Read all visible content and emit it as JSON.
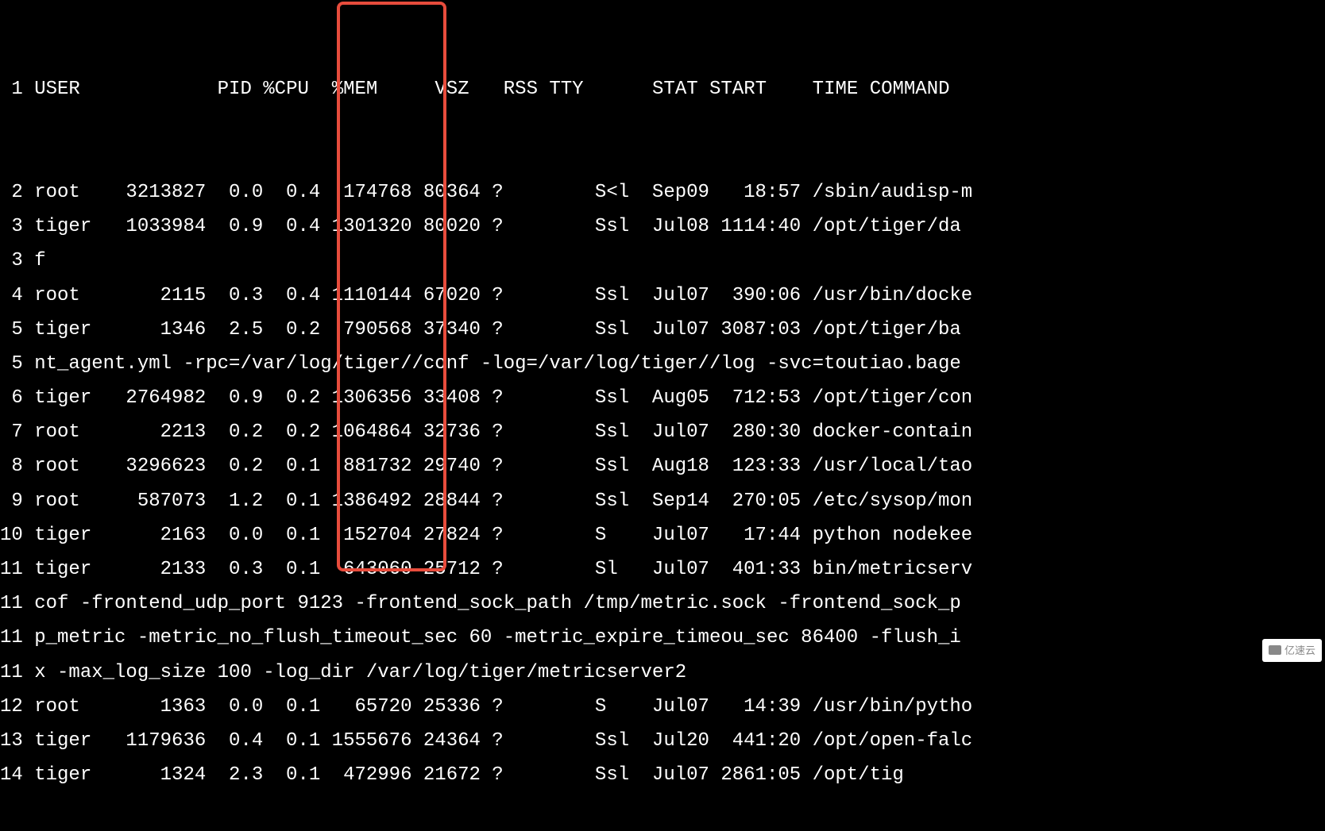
{
  "header": {
    "num": " 1",
    "user": "USER",
    "pid": "    PID",
    "cpu": "%CPU",
    "mem": "%MEM",
    "vsz": "    VSZ",
    "rss": "  RSS",
    "tty": "TTY",
    "stat": "STAT",
    "start": "START",
    "time": "   TIME",
    "command": "COMMAND"
  },
  "rows": [
    {
      "num": " 2",
      "user": "root ",
      "pid": "3213827",
      "cpu": " 0.0",
      "mem": " 0.4",
      "vsz": " 174768",
      "rss": "80364",
      "tty": "?       ",
      "stat": "S<l ",
      "start": "Sep09",
      "time": "  18:57",
      "command": "/sbin/audisp-m"
    },
    {
      "num": " 3",
      "user": "tiger",
      "pid": "1033984",
      "cpu": " 0.9",
      "mem": " 0.4",
      "vsz": "1301320",
      "rss": "80020",
      "tty": "?       ",
      "stat": "Ssl ",
      "start": "Jul08",
      "time": "1114:40",
      "command": "/opt/tiger/da"
    },
    {
      "num": " 3",
      "wrap": "f"
    },
    {
      "num": " 4",
      "user": "root ",
      "pid": "   2115",
      "cpu": " 0.3",
      "mem": " 0.4",
      "vsz": "1110144",
      "rss": "67020",
      "tty": "?       ",
      "stat": "Ssl ",
      "start": "Jul07",
      "time": " 390:06",
      "command": "/usr/bin/docke"
    },
    {
      "num": " 5",
      "user": "tiger",
      "pid": "   1346",
      "cpu": " 2.5",
      "mem": " 0.2",
      "vsz": " 790568",
      "rss": "37340",
      "tty": "?       ",
      "stat": "Ssl ",
      "start": "Jul07",
      "time": "3087:03",
      "command": "/opt/tiger/ba"
    },
    {
      "num": " 5",
      "wrap": "nt_agent.yml -rpc=/var/log/tiger//conf -log=/var/log/tiger//log -svc=toutiao.bage"
    },
    {
      "num": " 6",
      "user": "tiger",
      "pid": "2764982",
      "cpu": " 0.9",
      "mem": " 0.2",
      "vsz": "1306356",
      "rss": "33408",
      "tty": "?       ",
      "stat": "Ssl ",
      "start": "Aug05",
      "time": " 712:53",
      "command": "/opt/tiger/con"
    },
    {
      "num": " 7",
      "user": "root ",
      "pid": "   2213",
      "cpu": " 0.2",
      "mem": " 0.2",
      "vsz": "1064864",
      "rss": "32736",
      "tty": "?       ",
      "stat": "Ssl ",
      "start": "Jul07",
      "time": " 280:30",
      "command": "docker-contain"
    },
    {
      "num": " 8",
      "user": "root ",
      "pid": "3296623",
      "cpu": " 0.2",
      "mem": " 0.1",
      "vsz": " 881732",
      "rss": "29740",
      "tty": "?       ",
      "stat": "Ssl ",
      "start": "Aug18",
      "time": " 123:33",
      "command": "/usr/local/tao"
    },
    {
      "num": " 9",
      "user": "root ",
      "pid": " 587073",
      "cpu": " 1.2",
      "mem": " 0.1",
      "vsz": "1386492",
      "rss": "28844",
      "tty": "?       ",
      "stat": "Ssl ",
      "start": "Sep14",
      "time": " 270:05",
      "command": "/etc/sysop/mon"
    },
    {
      "num": "10",
      "user": "tiger",
      "pid": "   2163",
      "cpu": " 0.0",
      "mem": " 0.1",
      "vsz": " 152704",
      "rss": "27824",
      "tty": "?       ",
      "stat": "S   ",
      "start": "Jul07",
      "time": "  17:44",
      "command": "python nodekee"
    },
    {
      "num": "11",
      "user": "tiger",
      "pid": "   2133",
      "cpu": " 0.3",
      "mem": " 0.1",
      "vsz": " 643060",
      "rss": "25712",
      "tty": "?       ",
      "stat": "Sl  ",
      "start": "Jul07",
      "time": " 401:33",
      "command": "bin/metricserv"
    },
    {
      "num": "11",
      "wrap": "cof -frontend_udp_port 9123 -frontend_sock_path /tmp/metric.sock -frontend_sock_p"
    },
    {
      "num": "11",
      "wrap": "p_metric -metric_no_flush_timeout_sec 60 -metric_expire_timeou_sec 86400 -flush_i"
    },
    {
      "num": "11",
      "wrap": "x -max_log_size 100 -log_dir /var/log/tiger/metricserver2"
    },
    {
      "num": "12",
      "user": "root ",
      "pid": "   1363",
      "cpu": " 0.0",
      "mem": " 0.1",
      "vsz": "  65720",
      "rss": "25336",
      "tty": "?       ",
      "stat": "S   ",
      "start": "Jul07",
      "time": "  14:39",
      "command": "/usr/bin/pytho"
    },
    {
      "num": "13",
      "user": "tiger",
      "pid": "1179636",
      "cpu": " 0.4",
      "mem": " 0.1",
      "vsz": "1555676",
      "rss": "24364",
      "tty": "?       ",
      "stat": "Ssl ",
      "start": "Jul20",
      "time": " 441:20",
      "command": "/opt/open-falc"
    },
    {
      "num": "14",
      "user": "tiger",
      "pid": "   1324",
      "cpu": " 2.3",
      "mem": " 0.1",
      "vsz": " 472996",
      "rss": "21672",
      "tty": "?       ",
      "stat": "Ssl ",
      "start": "Jul07",
      "time": "2861:05",
      "command": "/opt/tig"
    }
  ],
  "watermark": {
    "text": "亿速云"
  }
}
